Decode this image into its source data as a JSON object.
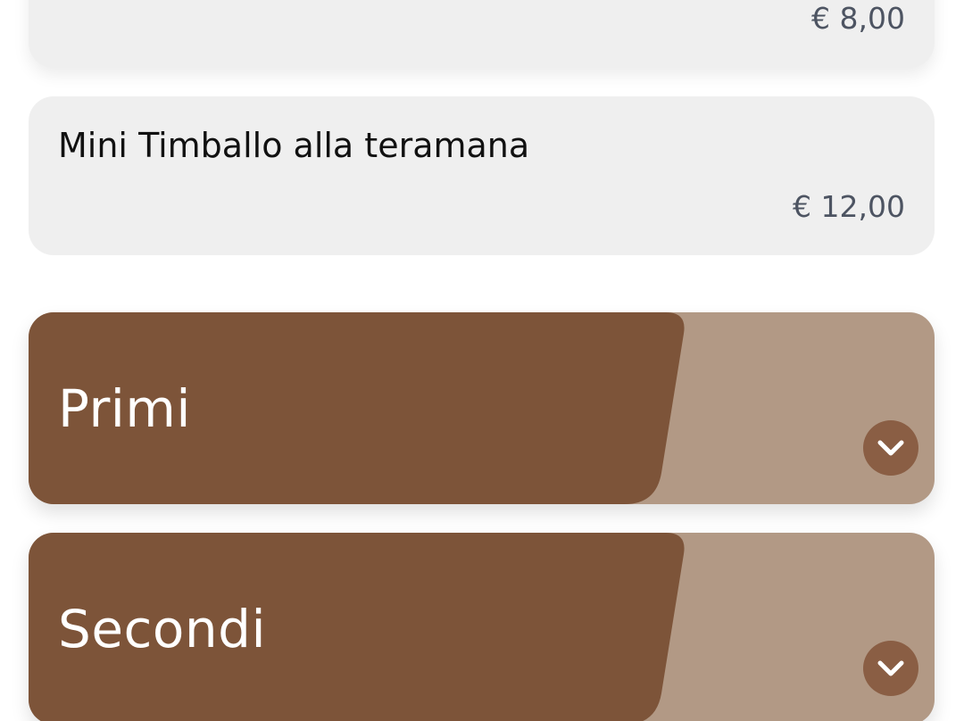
{
  "menu_items": [
    {
      "name": "",
      "price": "€ 8,00"
    },
    {
      "name": "Mini Timballo alla teramana",
      "price": "€ 12,00"
    }
  ],
  "sections": [
    {
      "title": "Primi",
      "toggle_icon": "chevron-down-icon",
      "expanded": false
    },
    {
      "title": "Secondi",
      "toggle_icon": "chevron-down-icon",
      "expanded": false
    }
  ],
  "colors": {
    "card_background": "#efefef",
    "section_primary": "#7d5439",
    "section_secondary": "#b29985",
    "toggle_button": "#8a5e44",
    "price_text": "#4d5462"
  }
}
